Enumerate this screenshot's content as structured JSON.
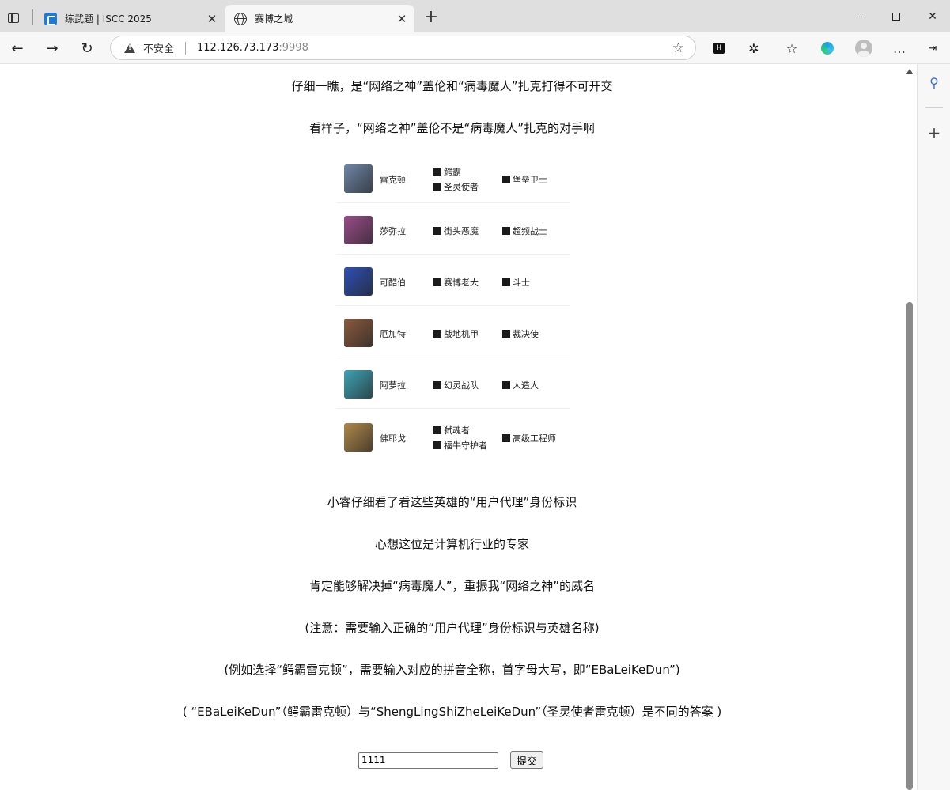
{
  "browser": {
    "tabs": [
      {
        "title": "练武题 | ISCC 2025",
        "favicon": "iscc-icon"
      },
      {
        "title": "赛博之城",
        "favicon": "globe-icon",
        "active": true
      }
    ],
    "address": {
      "security_label": "不安全",
      "host": "112.126.73.173",
      "port": ":9998"
    }
  },
  "page": {
    "lines_top": [
      "仔细一瞧，是“网络之神”盖伦和“病毒魔人”扎克打得不可开交",
      "看样子，“网络之神”盖伦不是“病毒魔人”扎克的对手啊"
    ],
    "heroes": [
      {
        "name": "雷克顿",
        "traits_a": [
          "鳄霸",
          "圣灵使者"
        ],
        "traits_b": [
          "堡垒卫士"
        ],
        "color": "#6f86a8"
      },
      {
        "name": "莎弥拉",
        "traits_a": [
          "街头恶魔"
        ],
        "traits_b": [
          "超频战士"
        ],
        "color": "#9a4d8a"
      },
      {
        "name": "可酷伯",
        "traits_a": [
          "赛博老大"
        ],
        "traits_b": [
          "斗士"
        ],
        "color": "#2f4fb4"
      },
      {
        "name": "厄加特",
        "traits_a": [
          "战地机甲"
        ],
        "traits_b": [
          "裁决使"
        ],
        "color": "#8a5a3e"
      },
      {
        "name": "阿萝拉",
        "traits_a": [
          "幻灵战队"
        ],
        "traits_b": [
          "人造人"
        ],
        "color": "#3fa3b6"
      },
      {
        "name": "佛耶戈",
        "traits_a": [
          "弑魂者",
          "福牛守护者"
        ],
        "traits_b": [
          "高级工程师"
        ],
        "color": "#b0884a"
      }
    ],
    "lines_bottom": [
      "小睿仔细看了看这些英雄的“用户代理”身份标识",
      "心想这位是计算机行业的专家",
      "肯定能够解决掉“病毒魔人”，重振我“网络之神”的威名",
      "(注意：需要输入正确的“用户代理”身份标识与英雄名称)",
      "(例如选择“鳄霸雷克顿”，需要输入对应的拼音全称，首字母大写，即“EBaLeiKeDun”)",
      "( “EBaLeiKeDun”（鳄霸雷克顿）与“ShengLingShiZheLeiKeDun”（圣灵使者雷克顿）是不同的答案 )"
    ],
    "form": {
      "input_value": "1111",
      "submit_label": "提交"
    }
  }
}
